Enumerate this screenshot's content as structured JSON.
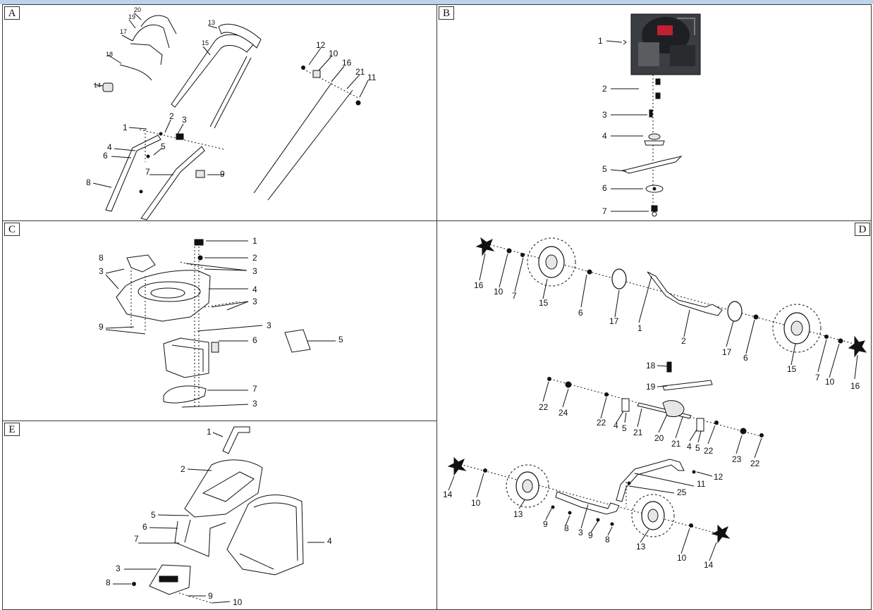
{
  "panels": {
    "A": {
      "tag": "A",
      "callouts": [
        "20",
        "19",
        "17",
        "18",
        "14",
        "13",
        "15",
        "12",
        "10",
        "16",
        "21",
        "11",
        "1",
        "2",
        "3",
        "4",
        "5",
        "6",
        "7",
        "8",
        "9"
      ]
    },
    "B": {
      "tag": "B",
      "callouts": [
        "1",
        "2",
        "3",
        "4",
        "5",
        "6",
        "7"
      ]
    },
    "C": {
      "tag": "C",
      "callouts": [
        "1",
        "2",
        "3",
        "8",
        "3",
        "4",
        "3",
        "9",
        "3",
        "6",
        "5",
        "7",
        "3"
      ]
    },
    "D": {
      "tag": "D",
      "callouts": [
        "16",
        "10",
        "7",
        "15",
        "6",
        "17",
        "1",
        "2",
        "17",
        "6",
        "15",
        "7",
        "10",
        "16",
        "18",
        "19",
        "22",
        "24",
        "22",
        "4",
        "5",
        "21",
        "20",
        "21",
        "4",
        "5",
        "22",
        "23",
        "22",
        "14",
        "10",
        "13",
        "9",
        "8",
        "3",
        "9",
        "8",
        "12",
        "11",
        "25",
        "13",
        "10",
        "14"
      ]
    },
    "E": {
      "tag": "E",
      "callouts": [
        "1",
        "2",
        "5",
        "6",
        "7",
        "4",
        "3",
        "8",
        "9",
        "10"
      ]
    }
  },
  "colors": {
    "frame": "#3a3a3a",
    "topbar": "#bcd3ea",
    "ink": "#111111"
  }
}
